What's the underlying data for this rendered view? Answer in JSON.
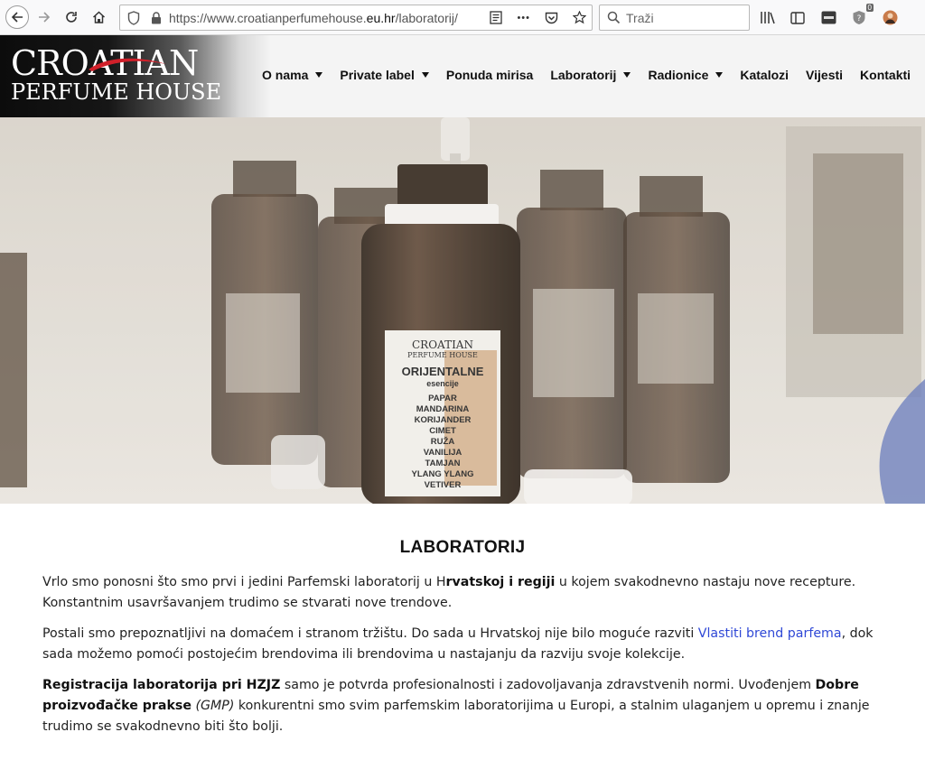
{
  "browser": {
    "url_prefix": "https://www.croatianperfumehouse.",
    "url_host": "eu.hr",
    "url_path": "/laboratorij/",
    "search_placeholder": "Traži",
    "ellipsis": "•••",
    "notification_count": "0"
  },
  "logo": {
    "line1": "CROATIAN",
    "line2": "PERFUME HOUSE"
  },
  "nav": {
    "items": [
      {
        "label": "O nama",
        "dropdown": true
      },
      {
        "label": "Private label",
        "dropdown": true
      },
      {
        "label": "Ponuda mirisa",
        "dropdown": false
      },
      {
        "label": "Laboratorij",
        "dropdown": true
      },
      {
        "label": "Radionice",
        "dropdown": true
      },
      {
        "label": "Katalozi",
        "dropdown": false
      },
      {
        "label": "Vijesti",
        "dropdown": false
      },
      {
        "label": "Kontakti",
        "dropdown": false
      }
    ]
  },
  "hero": {
    "label_brand_line1": "CROATIAN",
    "label_brand_line2": "PERFUME HOUSE",
    "label_title": "ORIJENTALNE",
    "label_subtitle": "esencije",
    "label_items": [
      "PAPAR",
      "MANDARINA",
      "KORIJANDER",
      "CIMET",
      "RUŽA",
      "VANILIJA",
      "TAMJAN",
      "YLANG YLANG",
      "VETIVER"
    ]
  },
  "content": {
    "title": "LABORATORIJ",
    "p1_a": "Vrlo smo ponosni što smo prvi i jedini Parfemski laboratorij u H",
    "p1_bold": "rvatskoj i regiji",
    "p1_b": " u kojem svakodnevno nastaju nove recepture. Konstantnim usavršavanjem trudimo se stvarati nove trendove.",
    "p2_a": "Postali smo prepoznatljivi na domaćem i stranom tržištu. Do sada u Hrvatskoj nije bilo moguće razviti ",
    "p2_link": "Vlastiti brend parfema",
    "p2_b": ", dok sada možemo pomoći postojećim brendovima ili brendovima u nastajanju da razviju svoje kolekcije.",
    "p3_bold1": "Registracija laboratorija pri HZJZ",
    "p3_a": " samo je potvrda profesionalnosti i zadovoljavanja zdravstvenih normi. Uvođenjem ",
    "p3_bold2": "Dobre proizvođačke prakse",
    "p3_italic": " (GMP)",
    "p3_b": " konkurentni smo svim parfemskim laboratorijima u Europi, a stalnim ulaganjem u opremu i znanje trudimo se svakodnevno biti što bolji."
  },
  "colors": {
    "link": "#2f48d6",
    "header_bg": "#f4f4f4",
    "logo_bg": "#0c0c0c",
    "logo_accent": "#d0202a"
  }
}
